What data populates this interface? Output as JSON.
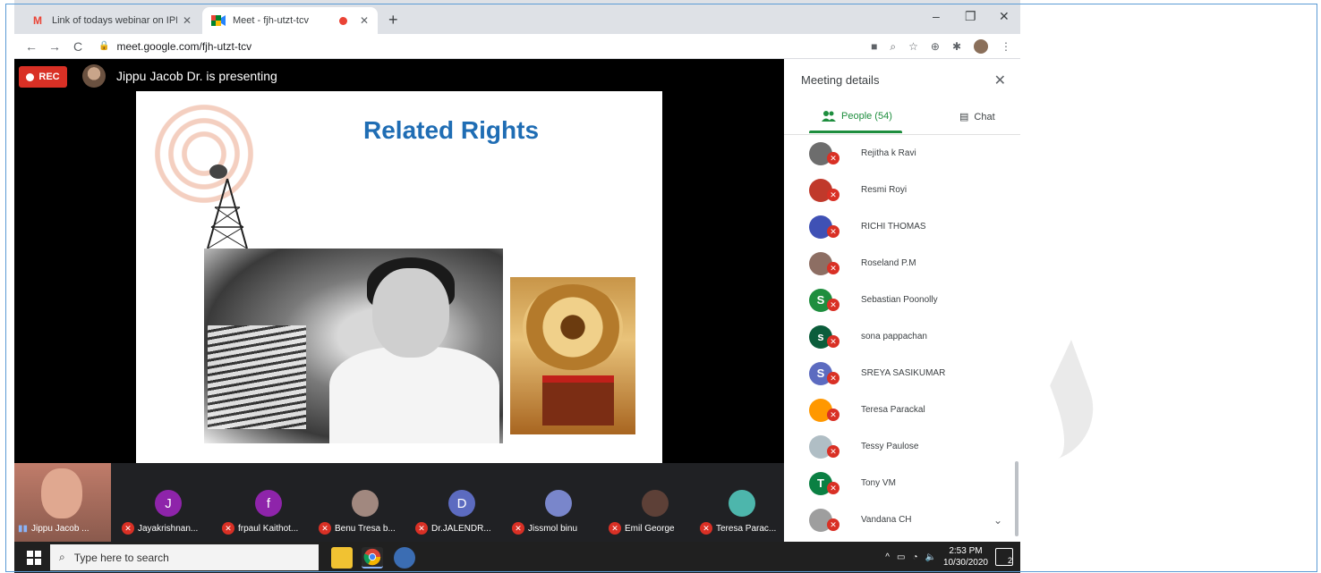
{
  "browser": {
    "tabs": [
      {
        "title": "Link of todays webinar on IPR - s",
        "favicon": "gmail-icon"
      },
      {
        "title": "Meet - fjh-utzt-tcv",
        "favicon": "meet-icon",
        "recording": true
      }
    ],
    "new_tab": "+",
    "window_controls": {
      "minimize": "–",
      "restore": "❐",
      "close": "✕"
    },
    "url": "meet.google.com/fjh-utzt-tcv"
  },
  "meeting": {
    "rec_label": "REC",
    "presenter_status": "Jippu Jacob Dr. is presenting",
    "slide": {
      "title": "Related Rights"
    }
  },
  "filmstrip": {
    "self": {
      "name": "Jippu Jacob ..."
    },
    "participants": [
      {
        "initial": "J",
        "name": "Jayakrishnan...",
        "color": "#8e24aa"
      },
      {
        "initial": "f",
        "name": "frpaul Kaithot...",
        "color": "#8e24aa"
      },
      {
        "initial": "",
        "name": "Benu Tresa b...",
        "color": "#a1887f"
      },
      {
        "initial": "D",
        "name": "Dr.JALENDR...",
        "color": "#5c6bc0"
      },
      {
        "initial": "",
        "name": "Jissmol binu",
        "color": "#7986cb"
      },
      {
        "initial": "",
        "name": "Emil George",
        "color": "#202124"
      },
      {
        "initial": "",
        "name": "Teresa Parac...",
        "color": "#4db6ac"
      }
    ]
  },
  "panel": {
    "title": "Meeting details",
    "tabs": {
      "people": "People (54)",
      "chat": "Chat"
    },
    "people": [
      {
        "name": "Rejitha k Ravi",
        "initial": "",
        "color": "#6d6d6d"
      },
      {
        "name": "Resmi Royi",
        "initial": "",
        "color": "#c0392b"
      },
      {
        "name": "RICHI THOMAS",
        "initial": "",
        "color": "#3f51b5"
      },
      {
        "name": "Roseland P.M",
        "initial": "",
        "color": "#8d6e63"
      },
      {
        "name": "Sebastian Poonolly",
        "initial": "S",
        "color": "#1e8e3e"
      },
      {
        "name": "sona pappachan",
        "initial": "s",
        "color": "#0b5d3b"
      },
      {
        "name": "SREYA SASIKUMAR",
        "initial": "S",
        "color": "#5c6bc0"
      },
      {
        "name": "Teresa Parackal",
        "initial": "",
        "color": "#ff9800"
      },
      {
        "name": "Tessy Paulose",
        "initial": "",
        "color": "#b0bec5"
      },
      {
        "name": "Tony VM",
        "initial": "T",
        "color": "#0b8043"
      },
      {
        "name": "Vandana CH",
        "initial": "",
        "color": "#9e9e9e"
      }
    ]
  },
  "taskbar": {
    "search_placeholder": "Type here to search",
    "time": "2:53 PM",
    "date": "10/30/2020",
    "notifications": "2"
  }
}
